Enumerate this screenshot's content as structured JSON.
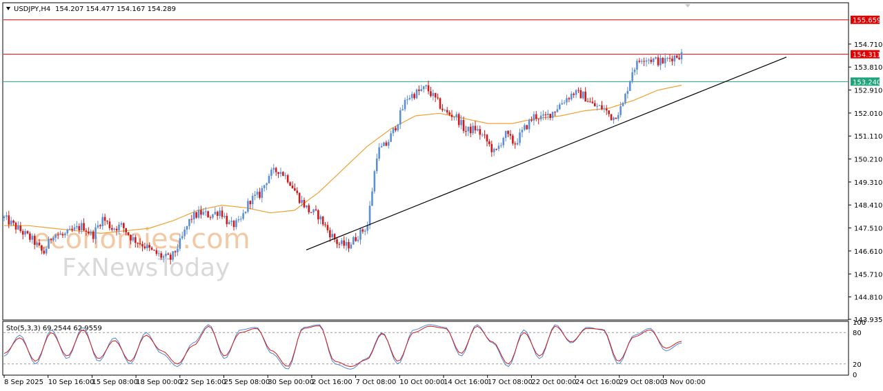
{
  "header": {
    "symbol": "USDJPY,H4",
    "ohlc": "154.207 154.477 154.167 154.289"
  },
  "watermark": {
    "line1": "economies.com",
    "line2": "FxNewsToday"
  },
  "price_levels": [
    {
      "value": 155.659,
      "label": "155.659",
      "color": "#e00000"
    },
    {
      "value": 154.311,
      "label": "154.311",
      "color": "#e00000"
    },
    {
      "value": 153.24,
      "label": "153.240",
      "color": "#1fa37a"
    }
  ],
  "chart_data": [
    {
      "type": "candlestick",
      "title": "USDJPY,H4",
      "ylim": [
        143.935,
        156.3
      ],
      "y_ticks": [
        "154.710",
        "153.810",
        "152.910",
        "152.010",
        "151.110",
        "150.210",
        "149.310",
        "148.410",
        "147.510",
        "146.610",
        "145.710",
        "144.810",
        "143.935"
      ],
      "x_ticks": [
        "8 Sep 2025",
        "10 Sep 16:00",
        "15 Sep 08:00",
        "18 Sep 00:00",
        "22 Sep 16:00",
        "25 Sep 08:00",
        "30 Sep 00:00",
        "2 Oct 16:00",
        "7 Oct 08:00",
        "10 Oct 00:00",
        "14 Oct 16:00",
        "17 Oct 08:00",
        "22 Oct 00:00",
        "24 Oct 16:00",
        "29 Oct 08:00",
        "3 Nov 00:00"
      ],
      "colors": {
        "up": "#5b8fd8",
        "down": "#d01818",
        "ma": "#f0a030",
        "trendline": "#000000"
      },
      "close_path": [
        147.9,
        147.6,
        147.3,
        147.0,
        146.5,
        147.3,
        147.2,
        147.4,
        147.6,
        147.2,
        147.9,
        147.5,
        147.6,
        147.1,
        146.9,
        146.6,
        146.4,
        146.3,
        147.0,
        147.9,
        148.1,
        148.0,
        148.2,
        147.6,
        147.7,
        148.6,
        148.8,
        149.6,
        149.8,
        149.4,
        148.7,
        148.2,
        148.0,
        147.4,
        146.9,
        146.8,
        147.2,
        147.6,
        150.5,
        150.8,
        151.6,
        152.6,
        152.8,
        153.0,
        152.5,
        152.0,
        151.9,
        151.3,
        151.4,
        151.0,
        150.4,
        151.2,
        150.8,
        151.4,
        151.9,
        151.8,
        152.1,
        152.5,
        152.8,
        152.7,
        152.3,
        152.2,
        151.8,
        152.3,
        153.7,
        154.2,
        154.1,
        154.0,
        154.2,
        154.3
      ],
      "ma_path": [
        147.6,
        147.6,
        147.5,
        147.4,
        147.3,
        147.4,
        147.5,
        147.8,
        148.2,
        148.4,
        148.3,
        148.1,
        148.2,
        148.9,
        149.8,
        150.7,
        151.4,
        151.9,
        152.0,
        151.8,
        151.6,
        151.6,
        151.8,
        151.9,
        152.1,
        152.2,
        152.5,
        152.9,
        153.1
      ],
      "trendline": [
        {
          "date": "1 Oct 2025",
          "value": 146.65
        },
        {
          "date": "6 Nov 2025",
          "value": 154.2
        }
      ]
    },
    {
      "type": "line",
      "title": "Sto(5,3,3) 69.2544 62.9559",
      "ylim": [
        0,
        100
      ],
      "y_ticks": [
        "100",
        "80",
        "20",
        "0"
      ],
      "series": [
        {
          "name": "main",
          "color": "#4f86d6",
          "values": [
            35,
            75,
            20,
            85,
            30,
            90,
            25,
            70,
            20,
            80,
            40,
            15,
            60,
            95,
            30,
            85,
            90,
            40,
            10,
            90,
            95,
            20,
            10,
            30,
            80,
            20,
            85,
            95,
            90,
            35,
            95,
            60,
            15,
            85,
            30,
            95,
            60,
            90,
            85,
            20,
            75,
            88,
            45,
            60
          ]
        },
        {
          "name": "signal",
          "color": "#d01818",
          "values": [
            40,
            70,
            25,
            80,
            35,
            85,
            30,
            65,
            25,
            75,
            45,
            20,
            55,
            92,
            35,
            80,
            88,
            45,
            15,
            88,
            93,
            25,
            15,
            28,
            78,
            25,
            80,
            92,
            88,
            40,
            92,
            62,
            20,
            80,
            35,
            92,
            62,
            88,
            86,
            25,
            72,
            85,
            50,
            63
          ]
        }
      ]
    }
  ]
}
